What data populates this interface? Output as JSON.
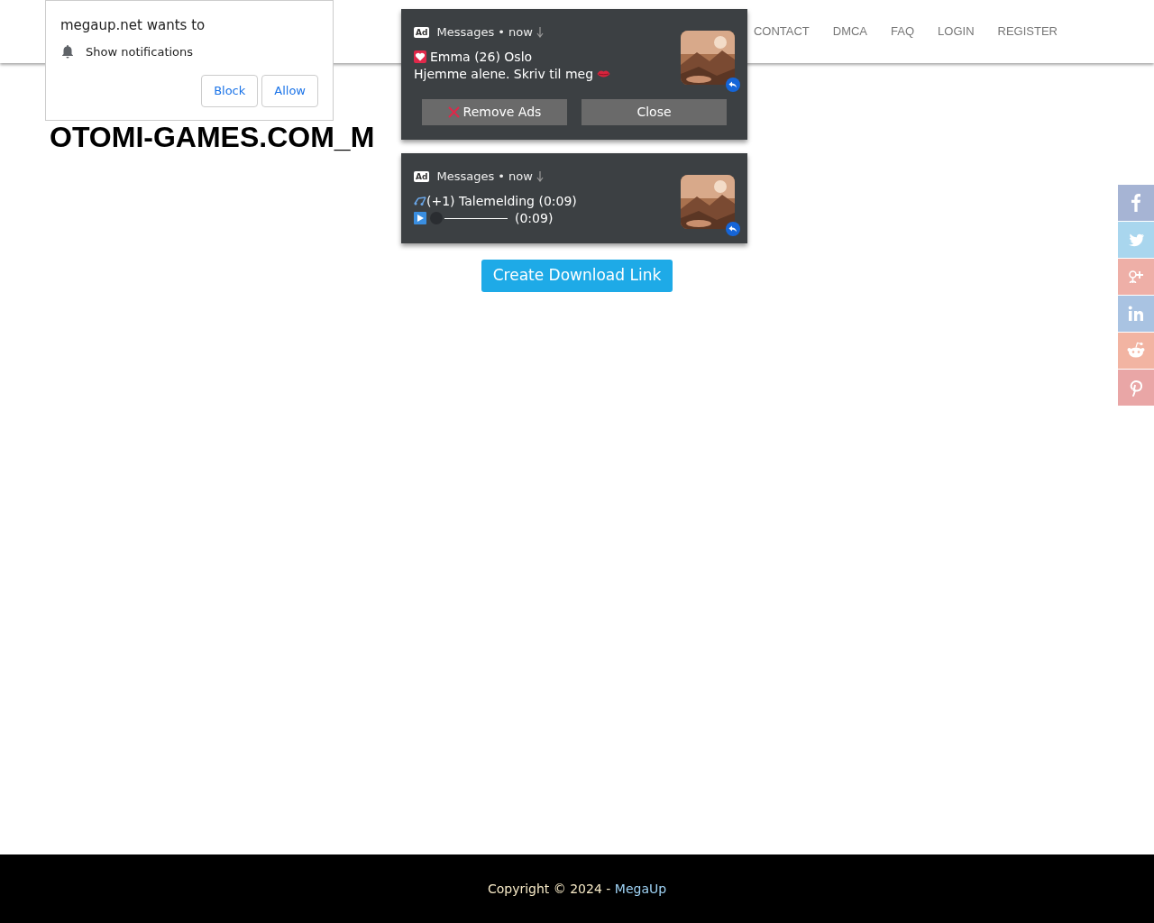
{
  "permission_prompt": {
    "origin_text": "megaup.net wants to",
    "permission": "Show notifications",
    "buttons": [
      "Block",
      "Allow"
    ]
  },
  "nav": [
    "CONTACT",
    "DMCA",
    "FAQ",
    "LOGIN",
    "REGISTER"
  ],
  "heading": "OTOMI-GAMES.COM_M",
  "download_button": "Create Download Link",
  "notifications": [
    {
      "kind": "message",
      "badge": "Ad",
      "meta": "Messages • now",
      "title": "Emma (26) Oslo",
      "body": "Hjemme alene. Skriv til meg",
      "buttons": [
        "Remove Ads",
        "Close"
      ]
    },
    {
      "kind": "voice",
      "badge": "Ad",
      "meta": "Messages • now",
      "title": "(+1) Talemelding (0:09)",
      "duration": "(0:09)"
    }
  ],
  "footer": {
    "text": "Copyright © 2024 - ",
    "link": "MegaUp"
  }
}
